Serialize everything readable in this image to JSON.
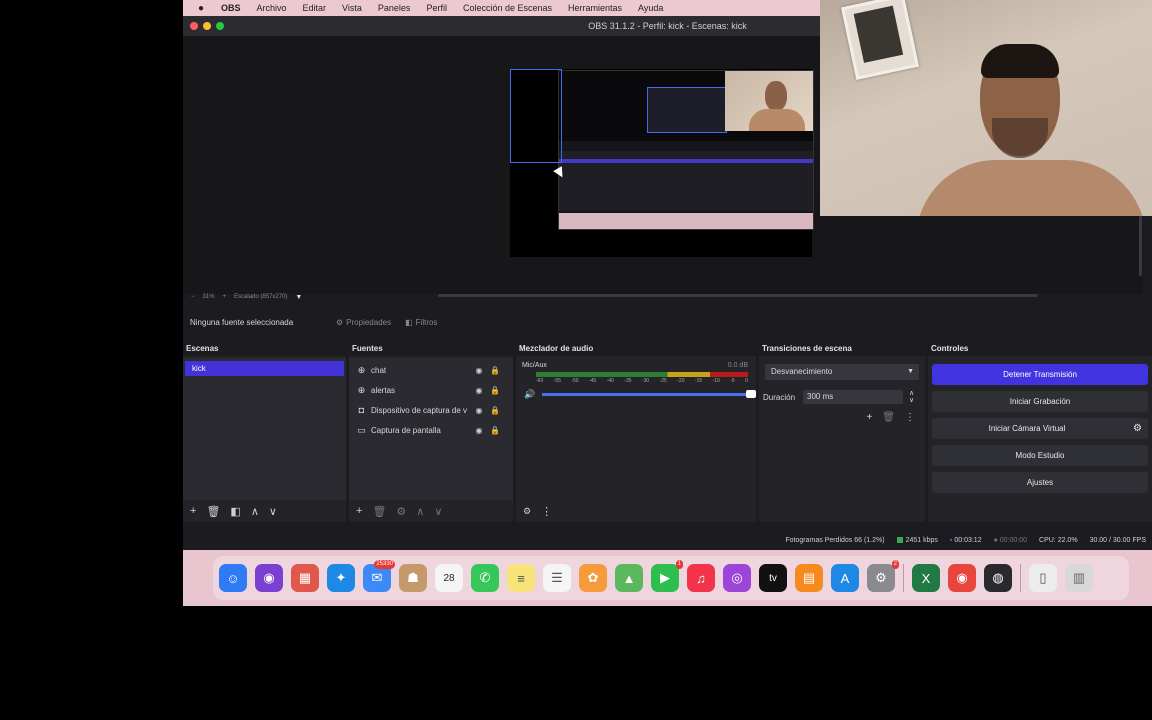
{
  "menubar": {
    "items": [
      "OBS",
      "Archivo",
      "Editar",
      "Vista",
      "Paneles",
      "Perfil",
      "Colección de Escenas",
      "Herramientas",
      "Ayuda"
    ]
  },
  "window": {
    "title": "OBS 31.1.2 - Perfil: kick - Escenas: kick",
    "traffic_colors": [
      "#ff5f57",
      "#febc2e",
      "#28c840"
    ]
  },
  "preview": {
    "zoom": "31%",
    "scale_label": "Escalado (857x270)"
  },
  "source_toolbar": {
    "no_source": "Ninguna fuente seleccionada",
    "properties": "Propiedades",
    "filters": "Filtros"
  },
  "docks": {
    "scenes": {
      "title": "Escenas",
      "items": [
        "kick"
      ]
    },
    "sources": {
      "title": "Fuentes",
      "items": [
        {
          "name": "chat",
          "icon": "globe-icon"
        },
        {
          "name": "alertas",
          "icon": "globe-icon"
        },
        {
          "name": "Dispositivo de captura de v",
          "icon": "camera-icon"
        },
        {
          "name": "Captura de pantalla",
          "icon": "monitor-icon"
        }
      ]
    },
    "mixer": {
      "title": "Mezclador de audio",
      "channel": "Mic/Aux",
      "db": "0.0 dB",
      "ticks": [
        "-60",
        "-55",
        "-50",
        "-45",
        "-40",
        "-35",
        "-30",
        "-25",
        "-20",
        "-15",
        "-10",
        "-5",
        "0"
      ]
    },
    "transitions": {
      "title": "Transiciones de escena",
      "selected": "Desvanecimiento",
      "duration_label": "Duración",
      "duration_value": "300 ms"
    },
    "controls": {
      "title": "Controles",
      "stop_stream": "Detener Transmisión",
      "start_recording": "Iniciar Grabación",
      "virtual_camera": "Iniciar Cámara Virtual",
      "studio_mode": "Modo Estudio",
      "settings": "Ajustes"
    }
  },
  "status": {
    "dropped": "Fotogramas Perdidos 66 (1.2%)",
    "bitrate": "2451 kbps",
    "stream_time": "00:03:12",
    "rec_time": "00:00:00",
    "cpu": "CPU: 22.0%",
    "fps": "30.00 / 30.00 FPS"
  },
  "dock_apps": [
    {
      "name": "finder-icon",
      "color": "#2f7bf5",
      "glyph": "☺"
    },
    {
      "name": "siri-icon",
      "color": "#7b3fd1",
      "glyph": "◉"
    },
    {
      "name": "launchpad-icon",
      "color": "#e2574c",
      "glyph": "▦"
    },
    {
      "name": "safari-icon",
      "color": "#1e88e5",
      "glyph": "✦"
    },
    {
      "name": "mail-icon",
      "color": "#3d8af7",
      "glyph": "✉",
      "badge": "25330"
    },
    {
      "name": "contacts-icon",
      "color": "#c49a6c",
      "glyph": "☗"
    },
    {
      "name": "calendar-icon",
      "color": "#f5f5f5",
      "glyph": "28",
      "text": "#222"
    },
    {
      "name": "messages-icon",
      "color": "#36c759",
      "glyph": "✆"
    },
    {
      "name": "notes-icon",
      "color": "#f8e27a",
      "glyph": "≡",
      "text": "#555"
    },
    {
      "name": "reminders-icon",
      "color": "#f5f5f5",
      "glyph": "☰",
      "text": "#555"
    },
    {
      "name": "photos-icon",
      "color": "#f59b3c",
      "glyph": "✿"
    },
    {
      "name": "maps-icon",
      "color": "#5cb85c",
      "glyph": "▲"
    },
    {
      "name": "facetime-icon",
      "color": "#2dbf4e",
      "glyph": "▶",
      "badge": "1"
    },
    {
      "name": "music-icon",
      "color": "#f1344b",
      "glyph": "♫"
    },
    {
      "name": "podcasts-icon",
      "color": "#9b46d9",
      "glyph": "◎"
    },
    {
      "name": "tv-icon",
      "color": "#111",
      "glyph": "tv"
    },
    {
      "name": "books-icon",
      "color": "#f58b1f",
      "glyph": "▤"
    },
    {
      "name": "app-store-icon",
      "color": "#1e88e5",
      "glyph": "A"
    },
    {
      "name": "system-settings-icon",
      "color": "#8a8a8e",
      "glyph": "⚙",
      "badge": "2"
    },
    {
      "name": "excel-icon",
      "color": "#1f7a44",
      "glyph": "X"
    },
    {
      "name": "chrome-icon",
      "color": "#e8453c",
      "glyph": "◉"
    },
    {
      "name": "obs-icon",
      "color": "#2a2a2e",
      "glyph": "◍"
    },
    {
      "name": "document-icon",
      "color": "#ececec",
      "glyph": "▯",
      "text": "#555"
    },
    {
      "name": "trash-icon",
      "color": "#d8d8d8",
      "glyph": "▥",
      "text": "#666"
    }
  ]
}
